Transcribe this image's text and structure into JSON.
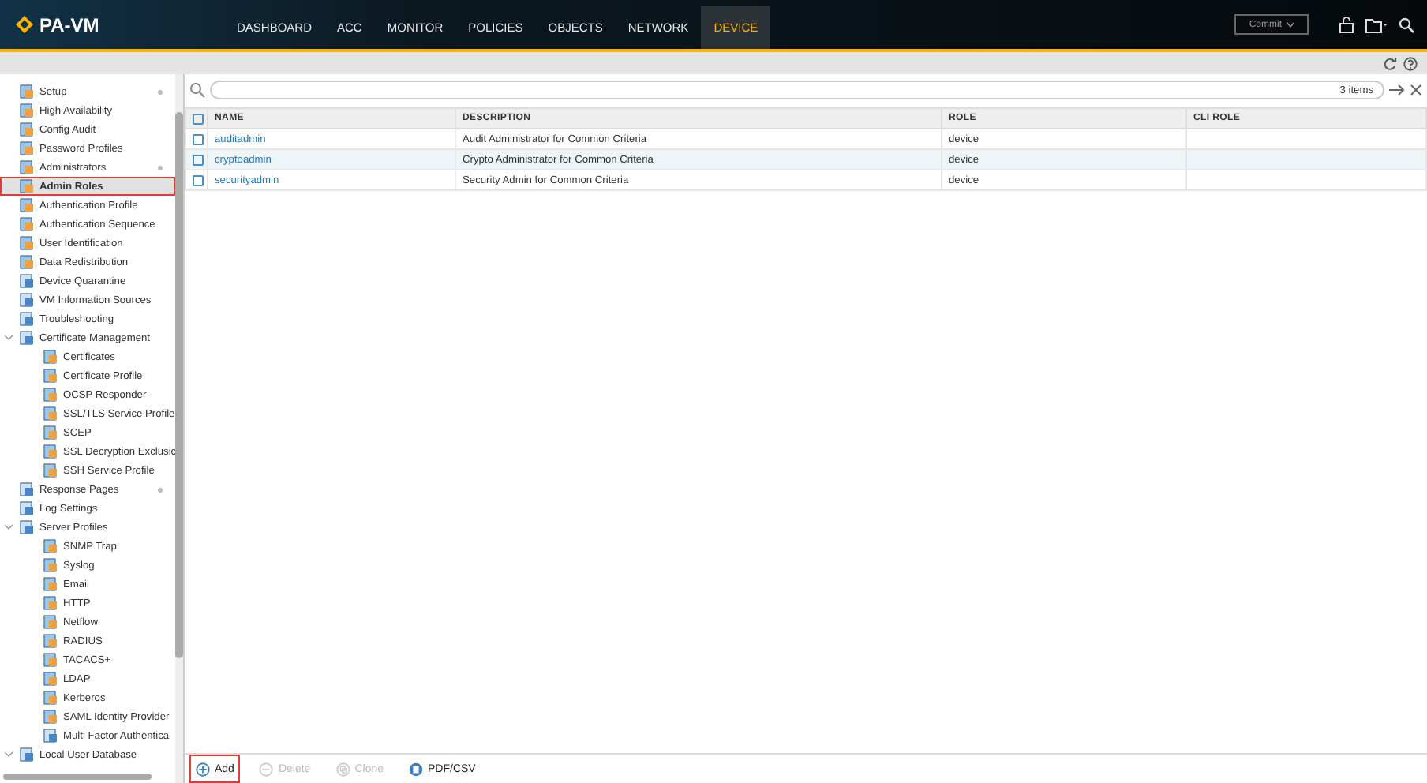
{
  "header": {
    "logo": "PA-VM",
    "tabs": [
      {
        "label": "DASHBOARD",
        "selected": false
      },
      {
        "label": "ACC",
        "selected": false
      },
      {
        "label": "MONITOR",
        "selected": false
      },
      {
        "label": "POLICIES",
        "selected": false
      },
      {
        "label": "OBJECTS",
        "selected": false
      },
      {
        "label": "NETWORK",
        "selected": false
      },
      {
        "label": "DEVICE",
        "selected": true
      }
    ],
    "commit": {
      "label": "Commit",
      "disabled": true
    }
  },
  "sidebar": {
    "items": [
      {
        "label": "Setup",
        "marker": true,
        "selected": false
      },
      {
        "label": "High Availability",
        "selected": false
      },
      {
        "label": "Config Audit",
        "selected": false
      },
      {
        "label": "Password Profiles",
        "selected": false
      },
      {
        "label": "Administrators",
        "marker": true,
        "selected": false
      },
      {
        "label": "Admin Roles",
        "selected": true
      },
      {
        "label": "Authentication Profile",
        "selected": false
      },
      {
        "label": "Authentication Sequence",
        "selected": false
      },
      {
        "label": "User Identification",
        "selected": false
      },
      {
        "label": "Data Redistribution",
        "selected": false
      },
      {
        "label": "Device Quarantine",
        "selected": false
      },
      {
        "label": "VM Information Sources",
        "selected": false
      },
      {
        "label": "Troubleshooting",
        "selected": false
      },
      {
        "label": "Certificate Management",
        "selected": false,
        "expanded": true,
        "children": [
          {
            "label": "Certificates",
            "selected": false
          },
          {
            "label": "Certificate Profile",
            "selected": false
          },
          {
            "label": "OCSP Responder",
            "selected": false
          },
          {
            "label": "SSL/TLS Service Profile",
            "selected": false
          },
          {
            "label": "SCEP",
            "selected": false
          },
          {
            "label": "SSL Decryption Exclusic",
            "selected": false
          },
          {
            "label": "SSH Service Profile",
            "selected": false
          }
        ]
      },
      {
        "label": "Response Pages",
        "marker": true,
        "selected": false
      },
      {
        "label": "Log Settings",
        "selected": false
      },
      {
        "label": "Server Profiles",
        "selected": false,
        "expanded": true,
        "children": [
          {
            "label": "SNMP Trap",
            "selected": false
          },
          {
            "label": "Syslog",
            "selected": false
          },
          {
            "label": "Email",
            "selected": false
          },
          {
            "label": "HTTP",
            "selected": false
          },
          {
            "label": "Netflow",
            "selected": false
          },
          {
            "label": "RADIUS",
            "selected": false
          },
          {
            "label": "TACACS+",
            "selected": false
          },
          {
            "label": "LDAP",
            "selected": false
          },
          {
            "label": "Kerberos",
            "selected": false
          },
          {
            "label": "SAML Identity Provider",
            "selected": false
          },
          {
            "label": "Multi Factor Authentica",
            "selected": false
          }
        ]
      },
      {
        "label": "Local User Database",
        "selected": false,
        "expanded": true
      }
    ]
  },
  "table": {
    "count": "3 items",
    "all_checked": false,
    "columns": [
      "NAME",
      "DESCRIPTION",
      "ROLE",
      "CLI ROLE"
    ],
    "rows": [
      {
        "checked": false,
        "cells": [
          "auditadmin",
          "Audit Administrator for Common Criteria",
          "device"
        ]
      },
      {
        "checked": false,
        "cells": [
          "cryptoadmin",
          "Crypto Administrator for Common Criteria",
          "device"
        ]
      },
      {
        "checked": false,
        "cells": [
          "securityadmin",
          "Security Admin for Common Criteria",
          "device"
        ]
      }
    ]
  },
  "actions": [
    {
      "label": "Add",
      "kind": "add",
      "disabled": false,
      "highlighted": true
    },
    {
      "label": "Delete",
      "kind": "delete",
      "disabled": true,
      "highlighted": false
    },
    {
      "label": "Clone",
      "kind": "clone",
      "disabled": true,
      "highlighted": false
    },
    {
      "label": "PDF/CSV",
      "kind": "export",
      "disabled": false,
      "highlighted": false
    }
  ]
}
